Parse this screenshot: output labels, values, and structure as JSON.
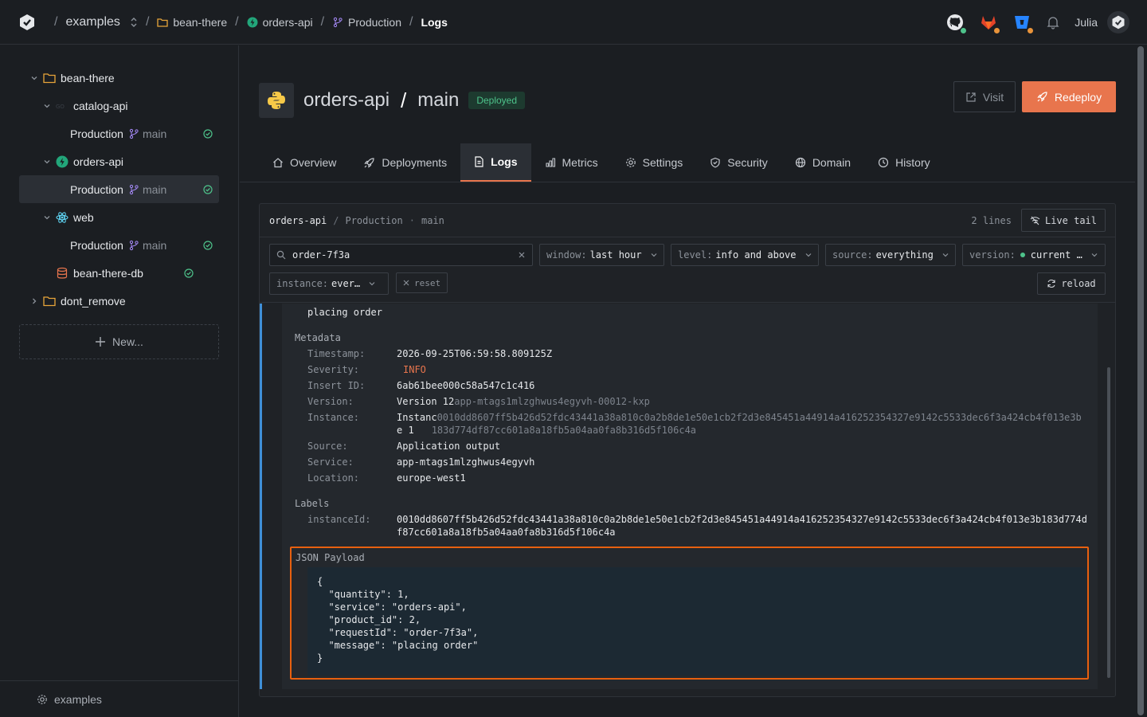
{
  "breadcrumb": {
    "workspace": "examples",
    "project": "bean-there",
    "service": "orders-api",
    "environment": "Production",
    "page": "Logs"
  },
  "user": {
    "name": "Julia"
  },
  "integrations": [
    {
      "icon": "github-icon",
      "status": "#4ec38b"
    },
    {
      "icon": "gitlab-icon",
      "status": "#e8933a"
    },
    {
      "icon": "bitbucket-icon",
      "status": "#e8933a"
    }
  ],
  "sidebar": {
    "project": "bean-there",
    "catalog_api": "catalog-api",
    "orders_api": "orders-api",
    "web": "web",
    "db": "bean-there-db",
    "dont_remove": "dont_remove",
    "env_label": "Production",
    "branch": "main",
    "new_label": "New...",
    "footer": "examples"
  },
  "header": {
    "service": "orders-api",
    "branch": "main",
    "status": "Deployed",
    "visit_label": "Visit",
    "redeploy_label": "Redeploy"
  },
  "tabs": [
    "Overview",
    "Deployments",
    "Logs",
    "Metrics",
    "Settings",
    "Security",
    "Domain",
    "History"
  ],
  "logs": {
    "path_service": "orders-api",
    "path_env": "Production",
    "path_branch": "main",
    "line_count": "2 lines",
    "live_tail_label": "Live tail",
    "search_value": "order-7f3a",
    "window_key": "window:",
    "window_val": "last hour",
    "level_key": "level:",
    "level_val": "info and above",
    "source_key": "source:",
    "source_val": "everything",
    "version_key": "version:",
    "version_val": "current …",
    "instance_key": "instance:",
    "instance_val": "ever…",
    "reset_label": "reset",
    "reload_label": "reload",
    "entry": {
      "message": "placing order",
      "metadata_title": "Metadata",
      "timestamp_key": "Timestamp:",
      "timestamp": "2026-09-25T06:59:58.809125Z",
      "severity_key": "Severity:",
      "severity": "INFO",
      "insert_id_key": "Insert ID:",
      "insert_id": "6ab61bee000c58a547c1c416",
      "version_key": "Version:",
      "version_main": "Version 12",
      "version_extra": "app-mtags1mlzghwus4egyvh-00012-kxp",
      "instance_key": "Instance:",
      "instance_main_1": "Instanc",
      "instance_extra_1": "0010dd8607ff5b426d52fdc43441a38a810c0a2b8de1e50e1cb2f2d3e845451a44914a416252354327e9142c5533dec6f3a424cb4f013e3b",
      "instance_main_2": "e 1",
      "instance_extra_2": "183d774df87cc601a8a18fb5a04aa0fa8b316d5f106c4a",
      "source_key": "Source:",
      "source": "Application output",
      "service_key": "Service:",
      "service": "app-mtags1mlzghwus4egyvh",
      "location_key": "Location:",
      "location": "europe-west1",
      "labels_title": "Labels",
      "instance_id_key": "instanceId:",
      "instance_id_1": "0010dd8607ff5b426d52fdc43441a38a810c0a2b8de1e50e1cb2f2d3e845451a44914a416252354327e9142c5533dec6f3a424cb4f013e3b183d774d",
      "instance_id_2": "f87cc601a8a18fb5a04aa0fa8b316d5f106c4a",
      "json_title": "JSON Payload",
      "json_payload": "{\n  \"quantity\": 1,\n  \"service\": \"orders-api\",\n  \"product_id\": 2,\n  \"requestId\": \"order-7f3a\",\n  \"message\": \"placing order\"\n}"
    }
  }
}
